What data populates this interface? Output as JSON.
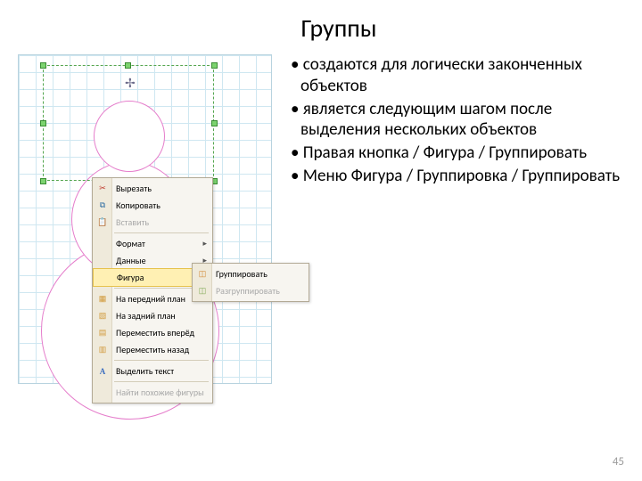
{
  "title": "Группы",
  "bullets": [
    "создаются для логически законченных объектов",
    "является следующим шагом после выделения нескольких объектов",
    "Правая кнопка / Фигура / Группировать",
    "Меню Фигура / Группировка / Группировать"
  ],
  "context_menu": {
    "items": {
      "cut": "Вырезать",
      "copy": "Копировать",
      "paste": "Вставить",
      "format": "Формат",
      "data": "Данные",
      "figure": "Фигура",
      "front": "На передний план",
      "back": "На задний план",
      "fwd": "Переместить вперёд",
      "bwd": "Переместить назад",
      "seltext": "Выделить текст",
      "find": "Найти похожие фигуры"
    }
  },
  "submenu": {
    "group": "Группировать",
    "ungroup": "Разгруппировать"
  },
  "page_number": "45"
}
